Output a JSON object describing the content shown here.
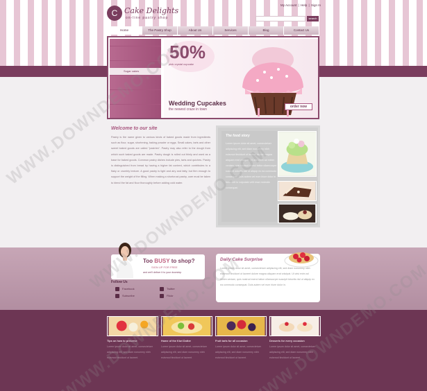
{
  "header": {
    "logo_glyph": "C",
    "logo_title": "Cake Delights",
    "logo_subtitle": "on-line pastry shop",
    "top_links": [
      "My Account",
      "|",
      "Help",
      "|",
      "Sign In"
    ],
    "search_placeholder": "",
    "search_button": "search"
  },
  "nav": {
    "items": [
      {
        "label": "Home",
        "active": true
      },
      {
        "label": "The Pastry Shop",
        "active": false
      },
      {
        "label": "About Us",
        "active": false
      },
      {
        "label": "Services",
        "active": false
      },
      {
        "label": "Blog",
        "active": false
      },
      {
        "label": "Contact Us",
        "active": false
      }
    ]
  },
  "side_menu": {
    "items": [
      {
        "label": "",
        "selected": false
      },
      {
        "label": "",
        "selected": false
      },
      {
        "label": "",
        "selected": false
      },
      {
        "label": "",
        "selected": false
      },
      {
        "label": "Sugar cakes",
        "selected": true
      },
      {
        "label": "",
        "selected": false
      },
      {
        "label": "",
        "selected": false
      },
      {
        "label": "",
        "selected": false
      },
      {
        "label": "",
        "selected": false
      },
      {
        "label": "",
        "selected": false
      },
      {
        "label": "",
        "selected": false
      }
    ]
  },
  "promo": {
    "percent": "50%",
    "percent_sub": "pink crystal cupcake",
    "title": "Wedding Cupcakes",
    "subtitle": "the newest craze in town",
    "order_button": "order now"
  },
  "welcome": {
    "title": "Welcome to our site",
    "body": "Pastry is the name given to various kinds of baked goods made from ingredients such as flour, sugar, shortening, baking powder or eggs. Small cakes, tarts and other sweet baked goods are called \"pastries\". Pastry may also refer to the dough from which such baked goods are made. Pastry dough is rolled out thinly and used as a base for baked goods. Common pastry dishes include pies, tarts and quiches. Pastry is distinguished from bread by having a higher fat content, which contributes to a flaky or crumbly texture. A good pastry is light and airy and fatty, but firm enough to support the weight of the filling. When making a shortcrust pastry, care must be taken to blend the fat and flour thoroughly before adding cold water."
  },
  "food_story": {
    "title": "The food story",
    "body": "Lorem ipsum dolor sit amet, consectetuer adipiscing elit, sed diam nonummy nibh euismod tincidunt ut laoreet dolore magna aliquam erat volutpat. Ut wisi enim ad minim veniam, quis nostrud exerci tation ullamcorper suscipit lobortis nisl ut aliquip ex ea commodo consequat. Duis autem vel eum iriure dolor in hendrerit in vulputate velit esse molestie consequat."
  },
  "busy": {
    "title_pre": "Too ",
    "title_em": "BUSY",
    "title_post": " to shop?",
    "sub": "SIGN UP FOR FREE",
    "sub2": "and we'll deliver it to your doorstep"
  },
  "follow": {
    "title": "Follow Us",
    "links": [
      {
        "label": "Facebook",
        "icon": "facebook-icon"
      },
      {
        "label": "Twitter",
        "icon": "twitter-icon"
      },
      {
        "label": "Subscribe",
        "icon": "email-icon"
      },
      {
        "label": "Flickr",
        "icon": "flickr-icon"
      }
    ]
  },
  "daily": {
    "title": "Daily Cake Surprise",
    "body": "Lorem ipsum dolor sit amet, consectetuer adipiscing elit, sed diam nonummy nibh euismod tincidunt ut laoreet dolore magna aliquam erat volutpat. Ut wisi enim ad minim veniam, quis nostrud exerci tation ullamcorper suscipit lobortis nisl ut aliquip ex ea commodo consequat. Duis autem vel eum iriure dolor in."
  },
  "features": [
    {
      "title": "Tips on how to preserve",
      "body": "Lorem ipsum dolor sit amet, consectetuer adipiscing elit, sed diam nonummy nibh euismod tincidunt ut laoreet."
    },
    {
      "title": "Home of the Kiwi Dotter",
      "body": "Lorem ipsum dolor sit amet, consectetuer adipiscing elit, sed diam nonummy nibh euismod tincidunt ut laoreet."
    },
    {
      "title": "Fruit tarts for all occasion",
      "body": "Lorem ipsum dolor sit amet, consectetuer adipiscing elit, sed diam nonummy nibh euismod tincidunt ut laoreet."
    },
    {
      "title": "Desserts for every occasion",
      "body": "Lorem ipsum dolor sit amet, consectetuer adipiscing elit, sed diam nonummy nibh euismod tincidunt ut laoreet."
    }
  ],
  "footer": "",
  "watermark": "WWW.DOWNDEMO.COM",
  "colors": {
    "plum": "#7a3d5e",
    "pink_stripe": "#e7c6d5",
    "menu": "#a8577f",
    "dark_footer": "#6d3654"
  }
}
